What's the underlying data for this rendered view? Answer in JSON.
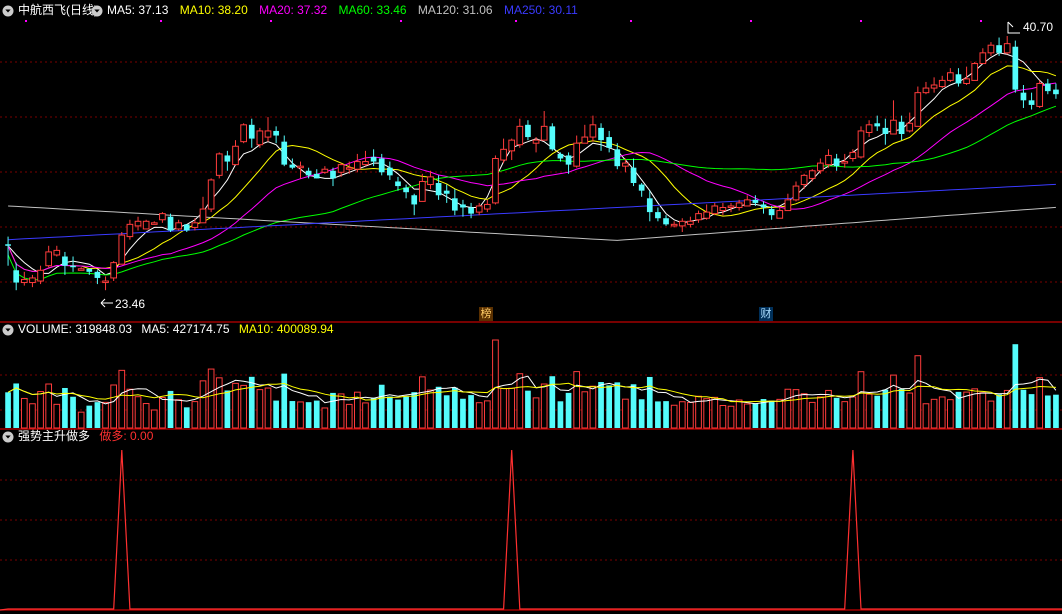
{
  "stock": {
    "title": "中航西飞(日线)",
    "ma_labels": [
      {
        "text": "MA5: 37.13",
        "color": "#ffffff"
      },
      {
        "text": "MA10: 38.20",
        "color": "#ffff00"
      },
      {
        "text": "MA20: 37.32",
        "color": "#ff00ff"
      },
      {
        "text": "MA60: 33.46",
        "color": "#00ff00"
      },
      {
        "text": "MA120: 31.06",
        "color": "#c0c0c0"
      },
      {
        "text": "MA250: 30.11",
        "color": "#3a3aff"
      }
    ],
    "high_label": "40.70",
    "low_label": "23.46",
    "markers": [
      "榜",
      "财"
    ]
  },
  "volume": {
    "labels": [
      {
        "text": "VOLUME: 319848.03",
        "color": "#ffffff"
      },
      {
        "text": "MA5: 427174.75",
        "color": "#ffffff"
      },
      {
        "text": "MA10: 400089.94",
        "color": "#ffff00"
      }
    ]
  },
  "indicator": {
    "name": "强势主升做多",
    "value_label": "做多: 0.00",
    "value_color": "#ff3030"
  },
  "colors": {
    "up": "#ff3c3c",
    "down": "#54fcfc",
    "grid": "#7a0000",
    "separator": "#c00000"
  },
  "chart_data": {
    "type": "candlestick",
    "ylim": [
      23.46,
      40.7
    ],
    "candles": [
      [
        27.1,
        27.0,
        27.6,
        25.7
      ],
      [
        25.4,
        24.6,
        25.9,
        24.1
      ],
      [
        24.6,
        24.8,
        25.3,
        24.4
      ],
      [
        24.6,
        24.9,
        25.1,
        24.3
      ],
      [
        24.7,
        25.4,
        25.7,
        24.5
      ],
      [
        25.7,
        26.6,
        27.0,
        25.6
      ],
      [
        26.4,
        26.7,
        27.0,
        26.3
      ],
      [
        26.3,
        25.7,
        26.6,
        25.1
      ],
      [
        25.7,
        25.6,
        26.3,
        25.3
      ],
      [
        25.4,
        25.5,
        25.6,
        25.4
      ],
      [
        25.5,
        25.3,
        25.5,
        25.1
      ],
      [
        25.3,
        24.9,
        25.4,
        24.5
      ],
      [
        24.6,
        24.7,
        25.0,
        24.1
      ],
      [
        24.9,
        25.9,
        26.0,
        24.7
      ],
      [
        25.8,
        27.7,
        27.9,
        25.8
      ],
      [
        27.6,
        28.4,
        28.7,
        27.4
      ],
      [
        28.3,
        28.6,
        28.9,
        28.0
      ],
      [
        28.1,
        28.6,
        28.7,
        28.1
      ],
      [
        28.4,
        28.5,
        28.6,
        28.4
      ],
      [
        28.7,
        29.1,
        29.2,
        28.5
      ],
      [
        28.9,
        28.0,
        29.1,
        27.9
      ],
      [
        28.1,
        28.5,
        28.7,
        28.0
      ],
      [
        28.4,
        28.0,
        28.4,
        27.9
      ],
      [
        28.2,
        28.5,
        28.8,
        28.0
      ],
      [
        28.5,
        29.4,
        30.2,
        28.5
      ],
      [
        29.4,
        31.3,
        31.4,
        29.2
      ],
      [
        31.6,
        33.0,
        33.1,
        31.4
      ],
      [
        32.9,
        32.5,
        33.2,
        31.9
      ],
      [
        32.3,
        33.5,
        33.9,
        32.3
      ],
      [
        33.8,
        34.9,
        35.0,
        33.7
      ],
      [
        34.9,
        34.0,
        35.3,
        33.4
      ],
      [
        33.6,
        34.5,
        34.7,
        33.4
      ],
      [
        34.1,
        34.5,
        35.4,
        33.8
      ],
      [
        34.5,
        34.2,
        34.8,
        33.7
      ],
      [
        33.8,
        32.3,
        34.2,
        32.2
      ],
      [
        32.3,
        32.1,
        32.7,
        32.0
      ],
      [
        32.1,
        32.2,
        32.5,
        31.4
      ],
      [
        31.9,
        31.6,
        32.1,
        31.4
      ],
      [
        31.7,
        31.4,
        32.0,
        31.4
      ],
      [
        31.8,
        32.0,
        32.2,
        31.7
      ],
      [
        31.9,
        31.4,
        32.1,
        30.9
      ],
      [
        31.8,
        32.3,
        32.4,
        31.5
      ],
      [
        32.0,
        32.1,
        32.5,
        31.7
      ],
      [
        32.0,
        32.5,
        33.0,
        31.8
      ],
      [
        32.3,
        32.5,
        33.2,
        32.2
      ],
      [
        32.8,
        32.5,
        33.3,
        32.2
      ],
      [
        32.7,
        31.8,
        33.0,
        31.6
      ],
      [
        32.1,
        31.6,
        32.5,
        31.3
      ],
      [
        31.2,
        30.9,
        31.5,
        30.6
      ],
      [
        30.8,
        30.5,
        31.0,
        30.1
      ],
      [
        30.3,
        29.7,
        30.4,
        29.0
      ],
      [
        29.9,
        31.2,
        31.7,
        29.9
      ],
      [
        31.0,
        31.5,
        31.9,
        30.7
      ],
      [
        31.1,
        30.3,
        31.6,
        30.0
      ],
      [
        30.6,
        30.4,
        31.0,
        29.8
      ],
      [
        30.1,
        29.3,
        30.7,
        29.0
      ],
      [
        29.7,
        29.5,
        30.0,
        28.9
      ],
      [
        29.5,
        29.1,
        29.8,
        28.8
      ],
      [
        29.2,
        29.6,
        29.8,
        29.0
      ],
      [
        29.4,
        29.7,
        30.0,
        29.2
      ],
      [
        29.8,
        32.7,
        32.9,
        29.7
      ],
      [
        32.6,
        33.3,
        34.0,
        32.4
      ],
      [
        33.2,
        33.9,
        34.0,
        32.6
      ],
      [
        33.6,
        34.8,
        35.3,
        33.4
      ],
      [
        34.9,
        34.1,
        35.2,
        33.9
      ],
      [
        33.7,
        33.9,
        34.1,
        33.1
      ],
      [
        33.9,
        34.8,
        35.8,
        33.9
      ],
      [
        34.8,
        33.3,
        35.0,
        33.2
      ],
      [
        33.0,
        32.7,
        33.1,
        32.5
      ],
      [
        32.9,
        32.3,
        33.1,
        31.7
      ],
      [
        32.2,
        33.7,
        34.2,
        32.1
      ],
      [
        33.7,
        34.1,
        34.9,
        33.7
      ],
      [
        34.1,
        34.9,
        35.5,
        33.8
      ],
      [
        34.7,
        33.9,
        35.0,
        33.2
      ],
      [
        34.1,
        33.4,
        34.5,
        33.1
      ],
      [
        33.3,
        32.2,
        33.7,
        32.0
      ],
      [
        32.2,
        32.4,
        32.7,
        31.8
      ],
      [
        32.1,
        31.1,
        32.7,
        30.9
      ],
      [
        31.0,
        30.6,
        31.1,
        30.2
      ],
      [
        30.1,
        29.2,
        30.6,
        28.6
      ],
      [
        29.2,
        28.8,
        29.5,
        28.6
      ],
      [
        28.8,
        28.4,
        29.0,
        28.3
      ],
      [
        28.3,
        28.4,
        28.6,
        28.2
      ],
      [
        28.3,
        28.6,
        28.8,
        27.9
      ],
      [
        28.4,
        28.6,
        28.9,
        28.2
      ],
      [
        28.7,
        29.1,
        29.3,
        28.5
      ],
      [
        28.8,
        29.2,
        29.7,
        28.7
      ],
      [
        29.1,
        29.6,
        29.8,
        29.0
      ],
      [
        29.3,
        29.5,
        29.8,
        29.0
      ],
      [
        29.5,
        29.6,
        29.8,
        29.2
      ],
      [
        29.5,
        29.8,
        30.0,
        29.3
      ],
      [
        29.6,
        30.0,
        30.3,
        29.6
      ],
      [
        30.0,
        29.8,
        30.3,
        29.6
      ],
      [
        29.7,
        29.5,
        29.9,
        29.1
      ],
      [
        29.4,
        29.0,
        29.6,
        28.7
      ],
      [
        28.8,
        29.3,
        29.5,
        28.8
      ],
      [
        29.3,
        30.0,
        30.4,
        29.3
      ],
      [
        30.0,
        30.9,
        31.2,
        29.9
      ],
      [
        31.0,
        31.6,
        31.7,
        30.7
      ],
      [
        31.4,
        31.9,
        32.0,
        31.2
      ],
      [
        31.9,
        32.4,
        32.7,
        31.7
      ],
      [
        32.3,
        32.9,
        33.3,
        32.1
      ],
      [
        32.7,
        32.2,
        33.0,
        31.9
      ],
      [
        32.4,
        32.5,
        33.0,
        32.1
      ],
      [
        32.7,
        33.1,
        33.3,
        32.5
      ],
      [
        32.8,
        34.5,
        34.8,
        32.7
      ],
      [
        34.4,
        34.9,
        35.2,
        34.1
      ],
      [
        35.0,
        34.8,
        35.5,
        34.5
      ],
      [
        34.7,
        34.3,
        35.3,
        33.6
      ],
      [
        34.3,
        35.2,
        36.5,
        34.3
      ],
      [
        35.1,
        34.3,
        35.5,
        33.9
      ],
      [
        34.5,
        35.0,
        35.7,
        34.4
      ],
      [
        34.8,
        37.0,
        37.4,
        34.8
      ],
      [
        37.0,
        37.3,
        37.7,
        36.9
      ],
      [
        37.3,
        37.5,
        38.0,
        37.0
      ],
      [
        37.4,
        37.8,
        38.1,
        37.3
      ],
      [
        37.8,
        38.3,
        38.6,
        37.7
      ],
      [
        38.2,
        37.6,
        38.6,
        37.4
      ],
      [
        37.6,
        37.9,
        38.7,
        37.5
      ],
      [
        37.8,
        38.9,
        39.0,
        37.8
      ],
      [
        38.9,
        39.6,
        39.9,
        38.9
      ],
      [
        39.6,
        40.1,
        40.3,
        39.4
      ],
      [
        40.1,
        39.6,
        40.6,
        39.4
      ],
      [
        39.6,
        40.2,
        40.7,
        39.5
      ],
      [
        40.0,
        37.2,
        40.4,
        37.0
      ],
      [
        37.0,
        36.5,
        37.5,
        36.0
      ],
      [
        36.5,
        36.2,
        37.0,
        35.9
      ],
      [
        36.1,
        37.6,
        37.8,
        36.0
      ],
      [
        37.6,
        37.1,
        37.9,
        36.9
      ],
      [
        37.2,
        36.9,
        37.6,
        36.6
      ]
    ],
    "ma": {
      "MA5": [
        27.0,
        26.4,
        25.9,
        25.5,
        25.2,
        25.2,
        25.6,
        25.9,
        26.0,
        25.9,
        25.8,
        25.5,
        25.1,
        25.3,
        26.1,
        26.8,
        27.4,
        27.9,
        28.2,
        28.2,
        28.0,
        28.2,
        28.4,
        28.7,
        29.2,
        30.0,
        30.6,
        31.3,
        32.3,
        33.0,
        33.2,
        33.6,
        33.8,
        33.6,
        33.0,
        32.4,
        32.0,
        31.6,
        31.5,
        31.4,
        31.4,
        31.6,
        31.8,
        32.0,
        32.2,
        32.4,
        32.4,
        32.1,
        31.7,
        31.2,
        30.7,
        30.7,
        30.6,
        30.5,
        30.2,
        29.9,
        29.6,
        29.5,
        29.5,
        30.2,
        31.4,
        32.5,
        33.4,
        33.6,
        33.8,
        34.0,
        33.8,
        33.4,
        33.0,
        32.7,
        32.9,
        33.3,
        33.7,
        33.6,
        33.4,
        33.2,
        32.6,
        32.0,
        31.3,
        30.6,
        29.8,
        29.1,
        28.7,
        28.5,
        28.6,
        28.7,
        28.8,
        29.1,
        29.2,
        29.4,
        29.6,
        29.7,
        29.7,
        29.6,
        29.5,
        29.6,
        29.9,
        30.3,
        30.8,
        31.3,
        31.9,
        32.2,
        32.4,
        32.6,
        33.1,
        33.5,
        33.9,
        34.1,
        34.4,
        34.5,
        34.6,
        35.1,
        35.6,
        36.1,
        36.6,
        37.2,
        37.5,
        37.7,
        38.0,
        38.4,
        38.9,
        39.3,
        39.6,
        39.5,
        39.3,
        39.0,
        38.4,
        37.8,
        37.3
      ]
    }
  }
}
